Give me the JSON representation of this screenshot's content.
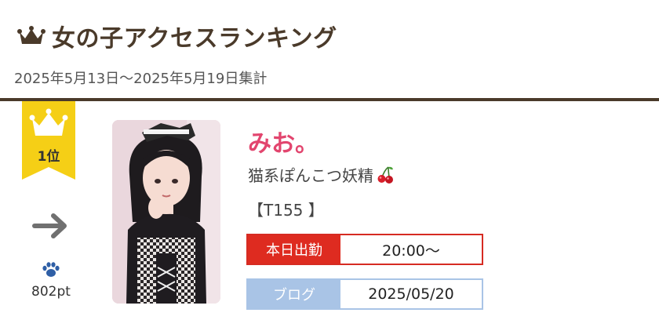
{
  "header": {
    "title": "女の子アクセスランキング",
    "period": "2025年5月13日〜2025年5月19日集計"
  },
  "ranking": {
    "rank_label": "1位",
    "trend": "arrow-right-icon",
    "points": "802pt"
  },
  "girl": {
    "name": "みお。",
    "catchphrase": "猫系ぽんこつ妖精",
    "height": "【T155 】",
    "work_label": "本日出勤",
    "work_time": "20:00〜",
    "blog_label": "ブログ",
    "blog_date": "2025/05/20"
  },
  "colors": {
    "title": "#4a3a2a",
    "badge_gold": "#f5cf16",
    "name_pink": "#e2456e",
    "work_red": "#de2b20",
    "blog_blue": "#a9c4e6"
  }
}
